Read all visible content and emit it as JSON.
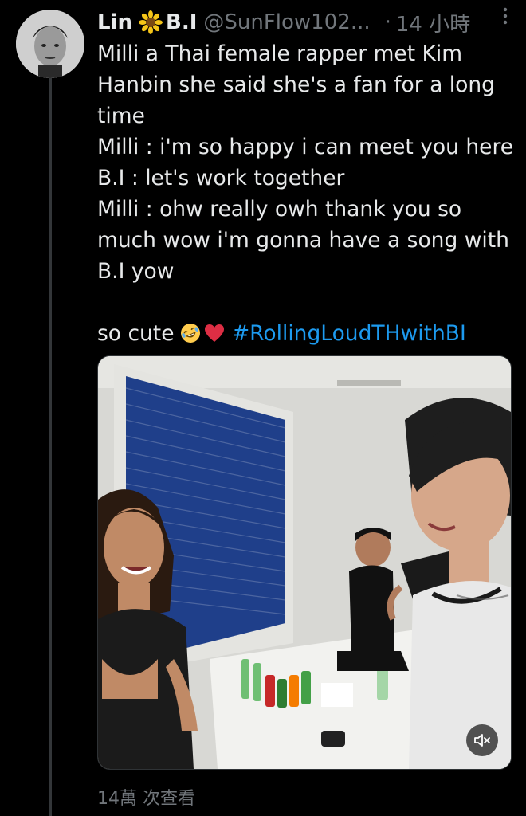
{
  "tweet": {
    "author_name": "Lin",
    "author_emoji_icon": "sunflower-icon",
    "author_name_suffix": "B.I",
    "handle": "@SunFlow102...",
    "time": "14 小時",
    "lines": [
      "Milli a Thai female rapper met Kim",
      "Hanbin she said she's a fan for a long",
      "time",
      "Milli : i'm so happy i can meet you here",
      "B.I : let's work together",
      "Milli : ohw really owh thank you so",
      "much wow i'm gonna have a song with",
      "B.I yow"
    ],
    "closing_text": "so cute",
    "closing_emojis": [
      "rofl-emoji-icon",
      "red-heart-icon"
    ],
    "hashtag": "#RollingLoudTHwithBI",
    "media": {
      "type": "video",
      "mute_icon": "speaker-muted-icon"
    },
    "views": "14萬 次查看"
  },
  "colors": {
    "background": "#000000",
    "text": "#e7e9ea",
    "secondary": "#71767b",
    "link": "#1d9bf0",
    "thread_line": "#333639"
  }
}
